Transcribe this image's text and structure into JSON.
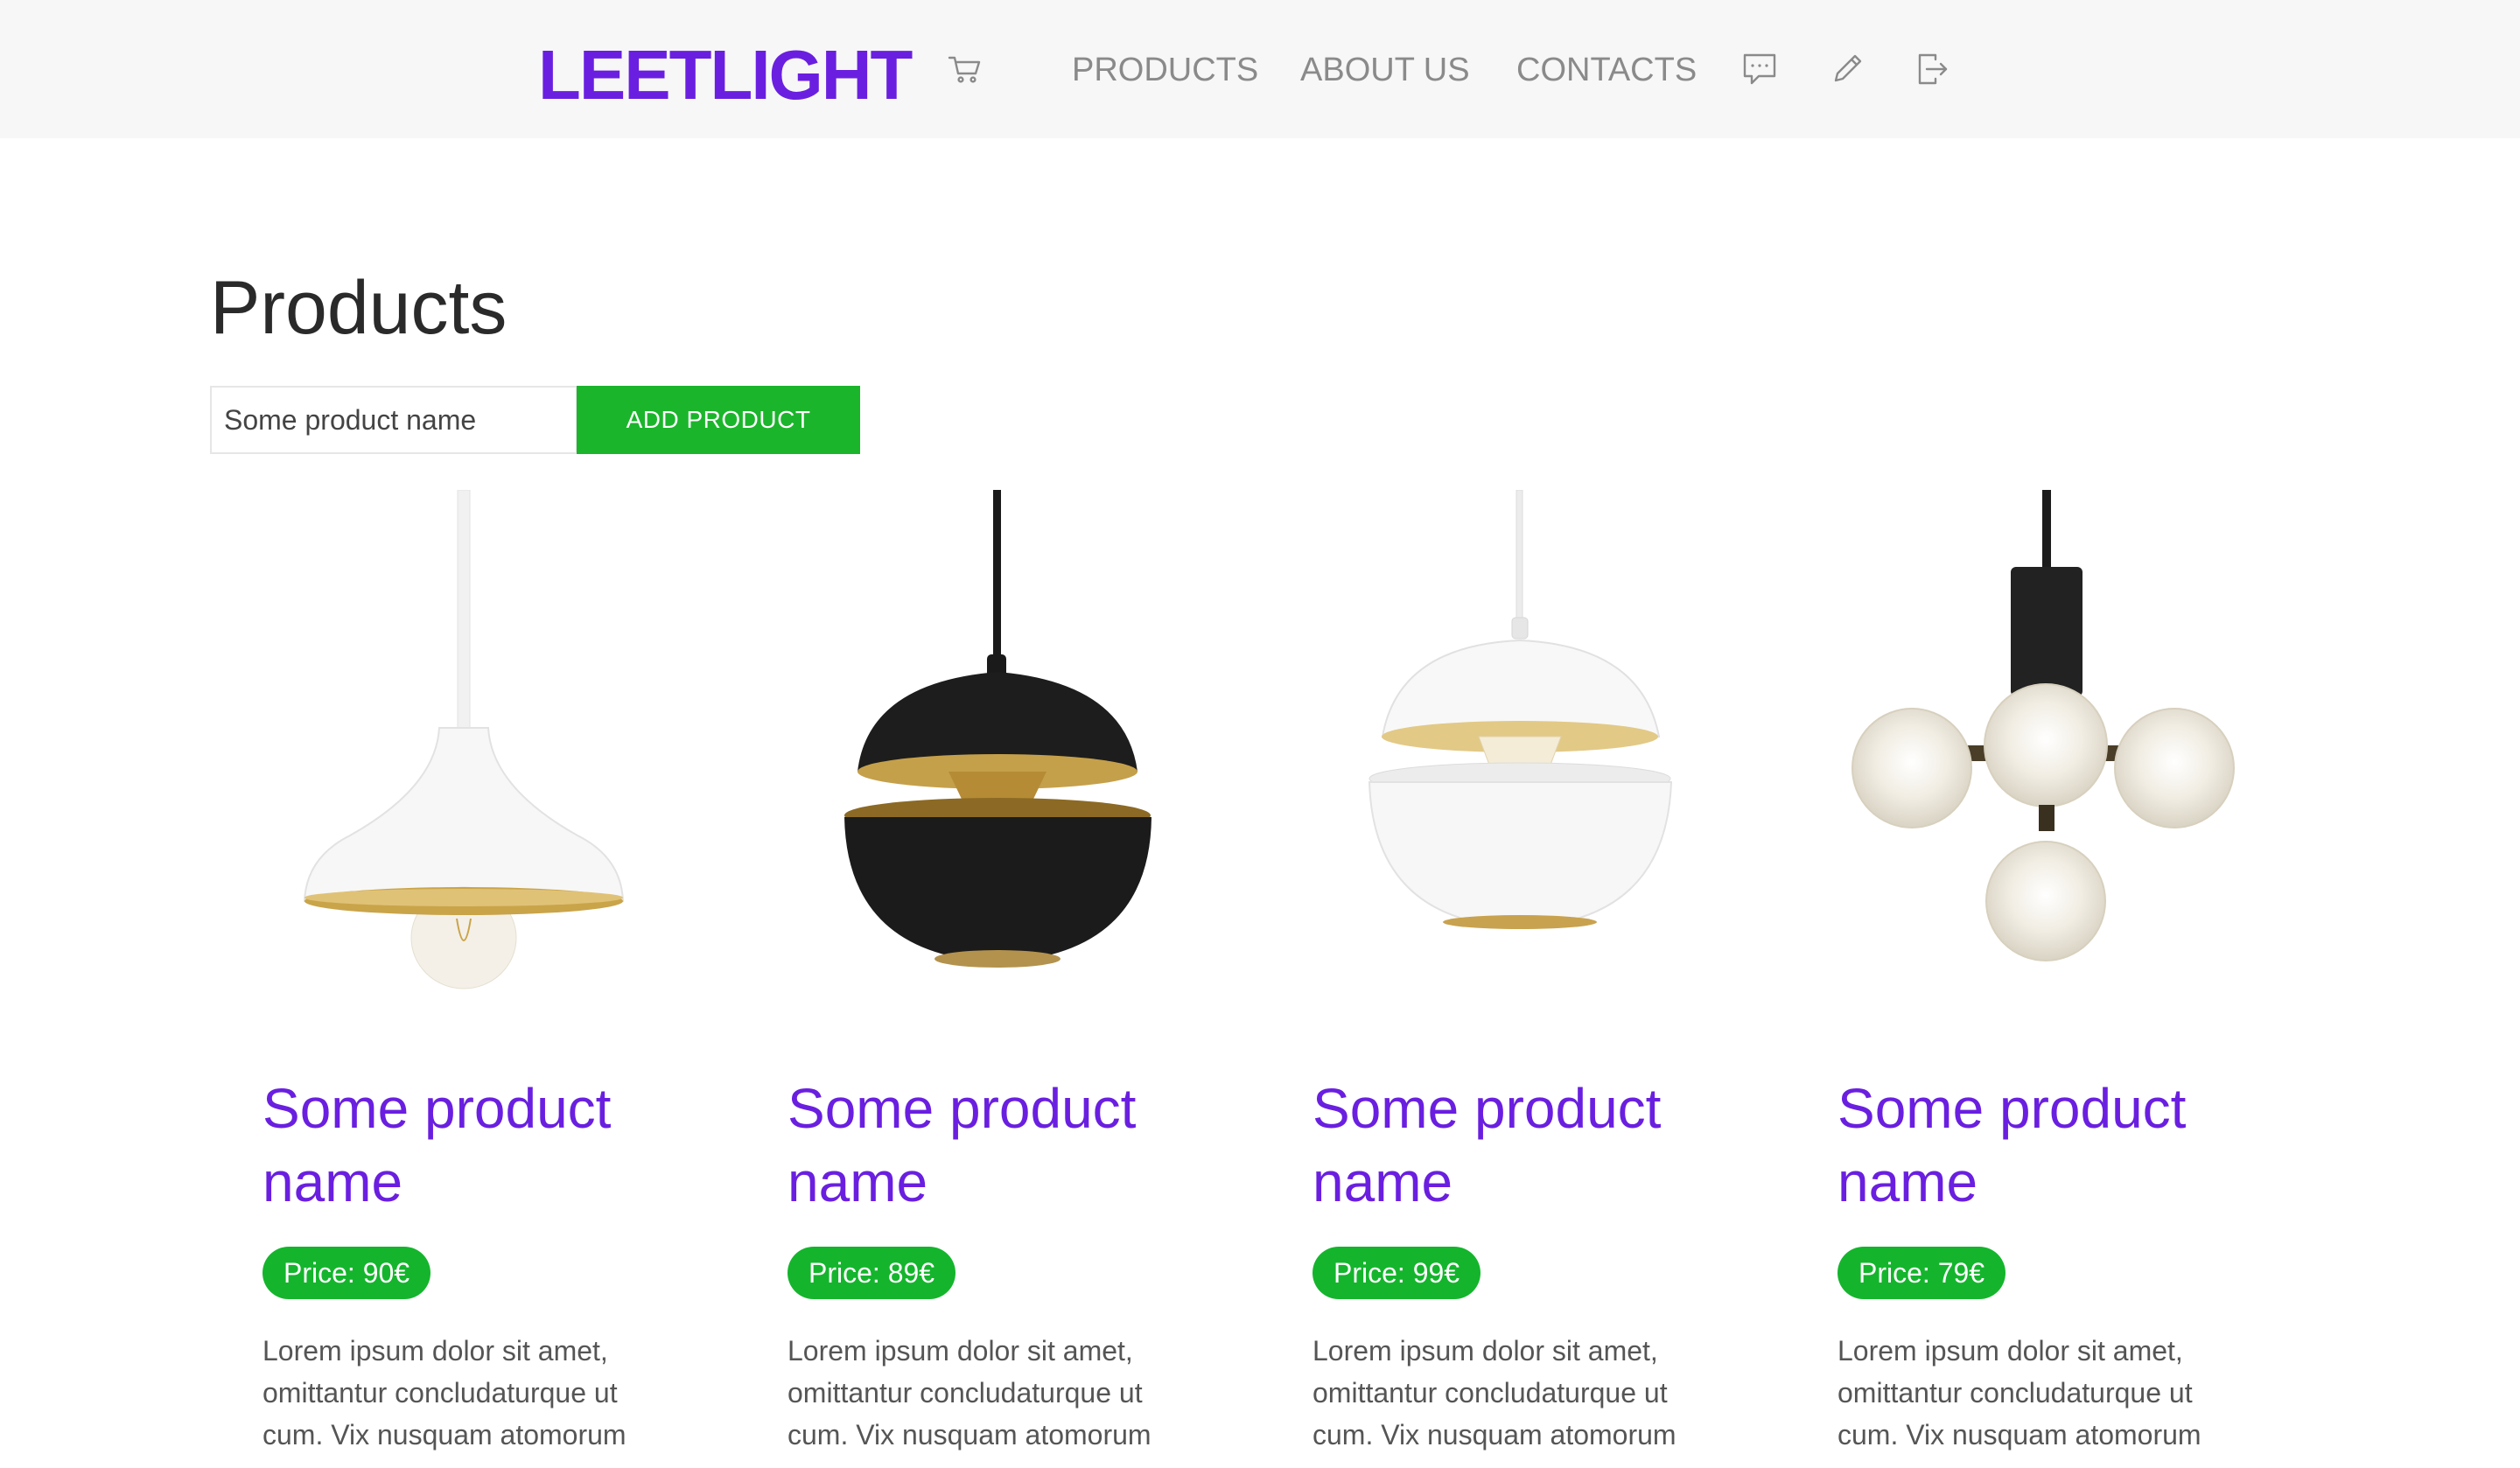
{
  "brand": {
    "name": "LEETLIGHT",
    "color": "#6a1fe0"
  },
  "header": {
    "cart_icon": "cart-icon",
    "nav": [
      {
        "label": "PRODUCTS"
      },
      {
        "label": "ABOUT US"
      },
      {
        "label": "CONTACTS"
      }
    ],
    "icons": [
      "chat-icon",
      "pencil-icon",
      "logout-icon"
    ]
  },
  "main": {
    "title": "Products",
    "input": {
      "value": "Some product name"
    },
    "add_button": "ADD PRODUCT",
    "accent_green": "#14b52c"
  },
  "products": [
    {
      "name": "Some product name",
      "price": "Price: 90€",
      "description": "Lorem ipsum dolor sit amet, omittantur concludaturque ut cum. Vix nusquam atomorum",
      "image": "white-cone-pendant-lamp"
    },
    {
      "name": "Some product name",
      "price": "Price: 89€",
      "description": "Lorem ipsum dolor sit amet, omittantur concludaturque ut cum. Vix nusquam atomorum",
      "image": "black-sphere-pendant-lamp"
    },
    {
      "name": "Some product name",
      "price": "Price: 99€",
      "description": "Lorem ipsum dolor sit amet, omittantur concludaturque ut cum. Vix nusquam atomorum",
      "image": "white-sphere-pendant-lamp"
    },
    {
      "name": "Some product name",
      "price": "Price: 79€",
      "description": "Lorem ipsum dolor sit amet, omittantur concludaturque ut cum. Vix nusquam atomorum",
      "image": "globe-cluster-pendant-lamp"
    }
  ]
}
